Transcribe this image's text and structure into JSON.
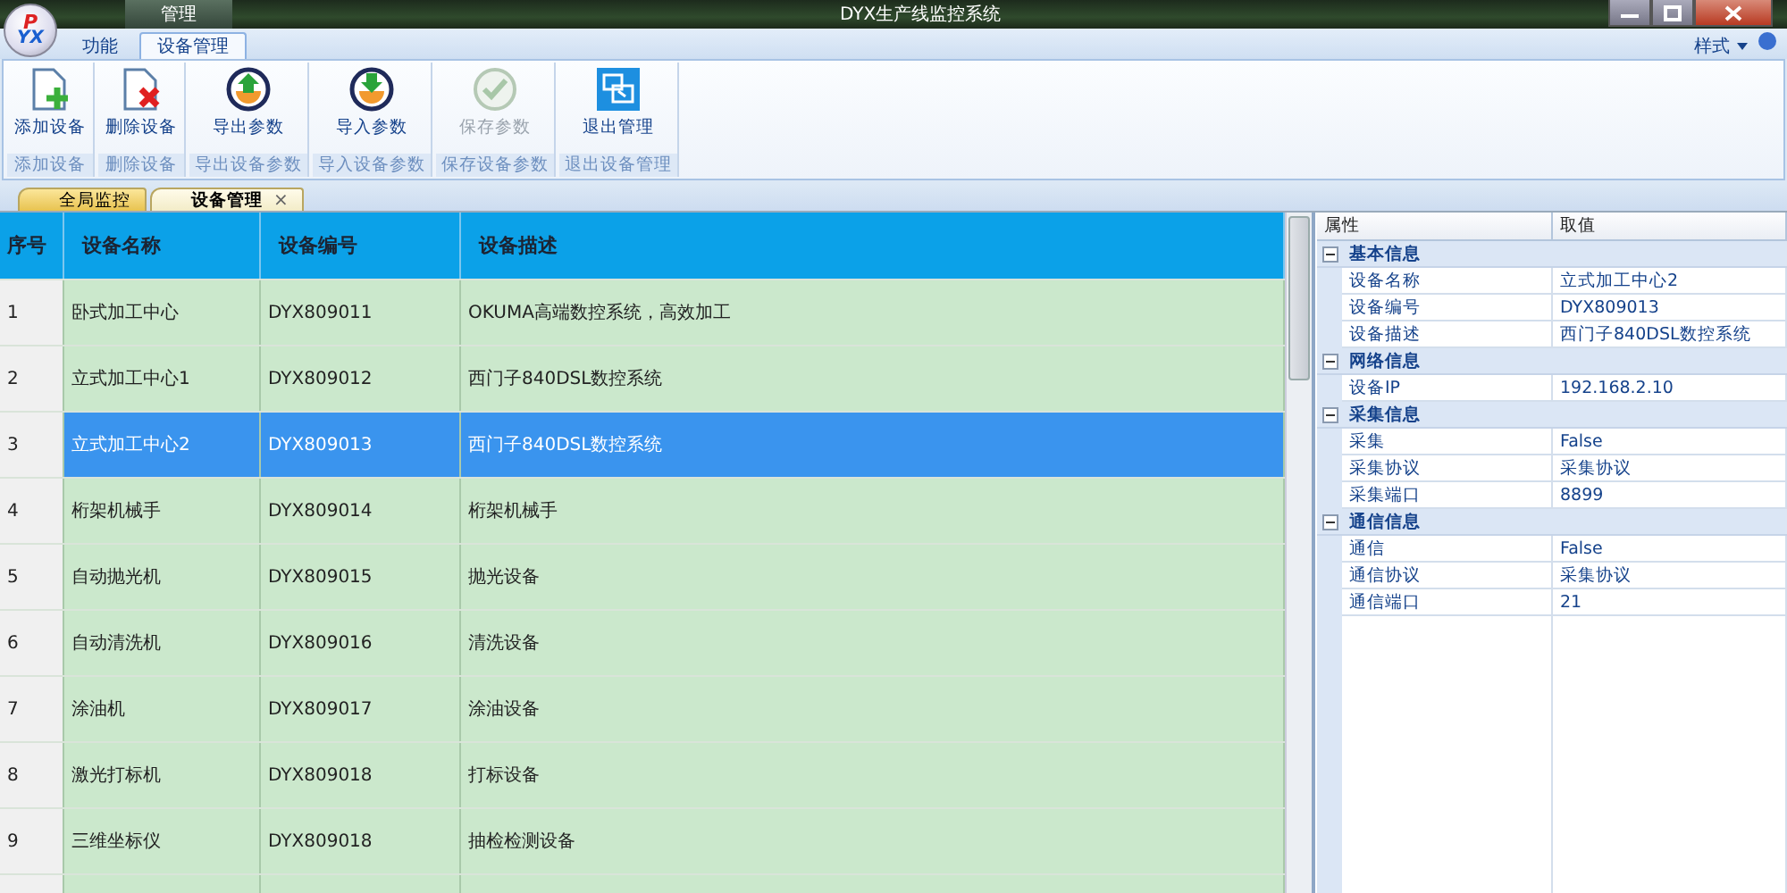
{
  "window": {
    "title": "DYX生产线监控系统",
    "context_tab": "管理",
    "logo": {
      "top": "P",
      "bottom": "YX"
    }
  },
  "ribbon_tabs": [
    {
      "label": "功能",
      "selected": false
    },
    {
      "label": "设备管理",
      "selected": true
    }
  ],
  "style_menu": "样式",
  "ribbon_groups": [
    {
      "label": "添加设备",
      "button": {
        "label": "添加设备",
        "kind": "add",
        "disabled": false
      }
    },
    {
      "label": "删除设备",
      "button": {
        "label": "删除设备",
        "kind": "delete",
        "disabled": false
      }
    },
    {
      "label": "导出设备参数",
      "button": {
        "label": "导出参数",
        "kind": "export",
        "disabled": false
      }
    },
    {
      "label": "导入设备参数",
      "button": {
        "label": "导入参数",
        "kind": "import",
        "disabled": false
      }
    },
    {
      "label": "保存设备参数",
      "button": {
        "label": "保存参数",
        "kind": "save",
        "disabled": true
      }
    },
    {
      "label": "退出设备管理",
      "button": {
        "label": "退出管理",
        "kind": "exit",
        "disabled": false
      }
    }
  ],
  "doc_tabs": [
    {
      "label": "全局监控",
      "selected": false,
      "closable": false
    },
    {
      "label": "设备管理",
      "selected": true,
      "closable": true
    }
  ],
  "close_glyph": "×",
  "table": {
    "columns": [
      "序号",
      "设备名称",
      "设备编号",
      "设备描述"
    ],
    "rows": [
      {
        "cells": [
          "1",
          "卧式加工中心",
          "DYX809011",
          "OKUMA高端数控系统，高效加工"
        ],
        "selected": false
      },
      {
        "cells": [
          "2",
          "立式加工中心1",
          "DYX809012",
          "西门子840DSL数控系统"
        ],
        "selected": false
      },
      {
        "cells": [
          "3",
          "立式加工中心2",
          "DYX809013",
          "西门子840DSL数控系统"
        ],
        "selected": true
      },
      {
        "cells": [
          "4",
          "桁架机械手",
          "DYX809014",
          "桁架机械手"
        ],
        "selected": false
      },
      {
        "cells": [
          "5",
          "自动抛光机",
          "DYX809015",
          "抛光设备"
        ],
        "selected": false
      },
      {
        "cells": [
          "6",
          "自动清洗机",
          "DYX809016",
          "清洗设备"
        ],
        "selected": false
      },
      {
        "cells": [
          "7",
          "涂油机",
          "DYX809017",
          "涂油设备"
        ],
        "selected": false
      },
      {
        "cells": [
          "8",
          "激光打标机",
          "DYX809018",
          "打标设备"
        ],
        "selected": false
      },
      {
        "cells": [
          "9",
          "三维坐标仪",
          "DYX809018",
          "抽检检测设备"
        ],
        "selected": false
      }
    ]
  },
  "properties": {
    "columns": [
      "属性",
      "取值"
    ],
    "categories": [
      {
        "name": "基本信息",
        "expanded": true,
        "children": [
          {
            "name": "设备名称",
            "value": "立式加工中心2"
          },
          {
            "name": "设备编号",
            "value": "DYX809013"
          },
          {
            "name": "设备描述",
            "value": "西门子840DSL数控系统"
          }
        ]
      },
      {
        "name": "网络信息",
        "expanded": true,
        "children": [
          {
            "name": "设备IP",
            "value": "192.168.2.10"
          }
        ]
      },
      {
        "name": "采集信息",
        "expanded": true,
        "children": [
          {
            "name": "采集",
            "value": "False"
          },
          {
            "name": "采集协议",
            "value": "采集协议"
          },
          {
            "name": "采集端口",
            "value": "8899"
          }
        ]
      },
      {
        "name": "通信信息",
        "expanded": true,
        "children": [
          {
            "name": "通信",
            "value": "False"
          },
          {
            "name": "通信协议",
            "value": "采集协议"
          },
          {
            "name": "通信端口",
            "value": "21"
          }
        ]
      }
    ]
  }
}
